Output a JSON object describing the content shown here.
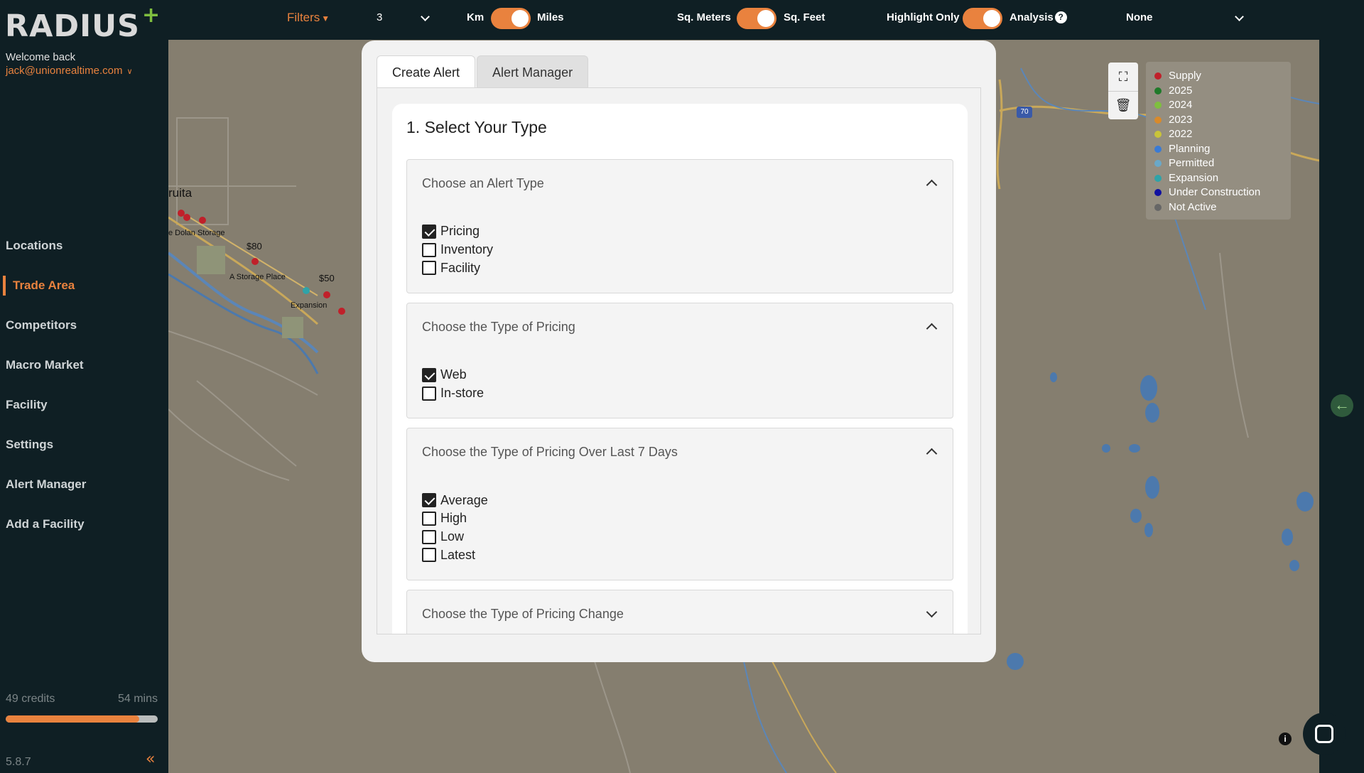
{
  "sidebar": {
    "logo": "RADIUS",
    "welcome": "Welcome back",
    "email": "jack@unionrealtime.com",
    "nav": [
      {
        "label": "Locations"
      },
      {
        "label": "Trade Area",
        "active": true
      },
      {
        "label": "Competitors"
      },
      {
        "label": "Macro Market"
      },
      {
        "label": "Facility"
      },
      {
        "label": "Settings"
      },
      {
        "label": "Alert Manager"
      },
      {
        "label": "Add a Facility"
      }
    ],
    "credits": "49 credits",
    "time_left": "54 mins",
    "credits_progress": 0.88,
    "version": "5.8.7"
  },
  "topbar": {
    "filters_label": "Filters",
    "radius_value": "3",
    "unit_left": "Km",
    "unit_right": "Miles",
    "area_left": "Sq. Meters",
    "area_right": "Sq. Feet",
    "highlight_left": "Highlight Only",
    "highlight_right": "Analysis",
    "analysis_value": "None"
  },
  "legend": [
    {
      "label": "Supply",
      "color": "#c0202a"
    },
    {
      "label": "2025",
      "color": "#1f7a2a"
    },
    {
      "label": "2024",
      "color": "#7fbf3f"
    },
    {
      "label": "2023",
      "color": "#d98a2b"
    },
    {
      "label": "2022",
      "color": "#c9c43a"
    },
    {
      "label": "Planning",
      "color": "#3a7bd5"
    },
    {
      "label": "Permitted",
      "color": "#6aa8c8"
    },
    {
      "label": "Expansion",
      "color": "#2fa3a8"
    },
    {
      "label": "Under Construction",
      "color": "#1010a0"
    },
    {
      "label": "Not Active",
      "color": "#666666"
    }
  ],
  "map": {
    "town": "ruita",
    "labels": [
      "e Dolan Storage",
      "A Storage Place",
      "Expansion"
    ],
    "prices": [
      "$80",
      "$50"
    ],
    "highway": "70"
  },
  "modal": {
    "tabs": [
      "Create Alert",
      "Alert Manager"
    ],
    "card_title": "1. Select Your Type",
    "sections": [
      {
        "title": "Choose an Alert Type",
        "expanded": true,
        "options": [
          {
            "label": "Pricing",
            "checked": true
          },
          {
            "label": "Inventory",
            "checked": false
          },
          {
            "label": "Facility",
            "checked": false
          }
        ]
      },
      {
        "title": "Choose the Type of Pricing",
        "expanded": true,
        "options": [
          {
            "label": "Web",
            "checked": true
          },
          {
            "label": "In-store",
            "checked": false
          }
        ]
      },
      {
        "title": "Choose the Type of Pricing Over Last 7 Days",
        "expanded": true,
        "options": [
          {
            "label": "Average",
            "checked": true
          },
          {
            "label": "High",
            "checked": false
          },
          {
            "label": "Low",
            "checked": false
          },
          {
            "label": "Latest",
            "checked": false
          }
        ]
      },
      {
        "title": "Choose the Type of Pricing Change",
        "expanded": false,
        "options": []
      }
    ]
  }
}
